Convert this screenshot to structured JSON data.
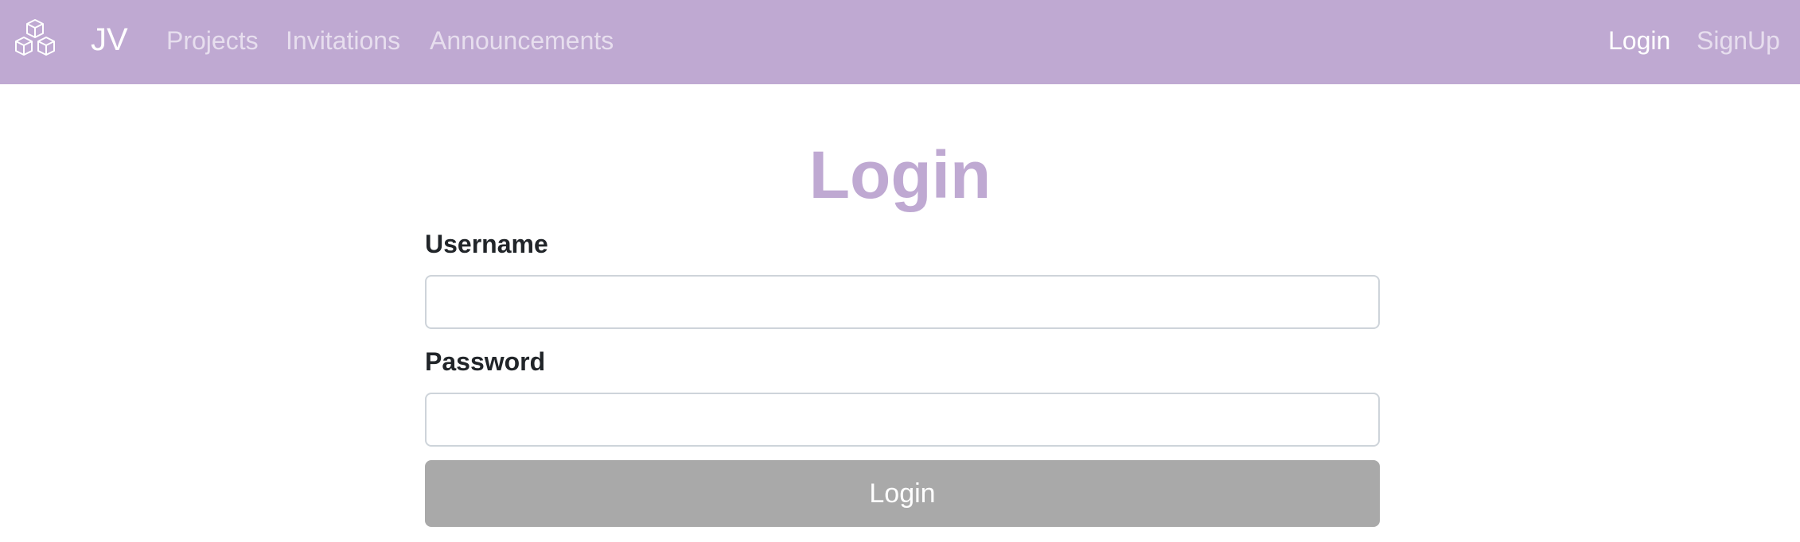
{
  "navbar": {
    "logo_icon": "cubes-icon",
    "brand": "JV",
    "links": [
      {
        "label": "Projects"
      },
      {
        "label": "Invitations"
      },
      {
        "label": "Announcements"
      }
    ],
    "right_links": [
      {
        "label": "Login",
        "active": true
      },
      {
        "label": "SignUp",
        "active": false
      }
    ],
    "background_color": "#bfa9d2"
  },
  "form": {
    "title": "Login",
    "title_color": "#bfa9d2",
    "username_label": "Username",
    "username_value": "",
    "password_label": "Password",
    "password_value": "",
    "submit_label": "Login",
    "submit_color": "#a9a9a9"
  }
}
